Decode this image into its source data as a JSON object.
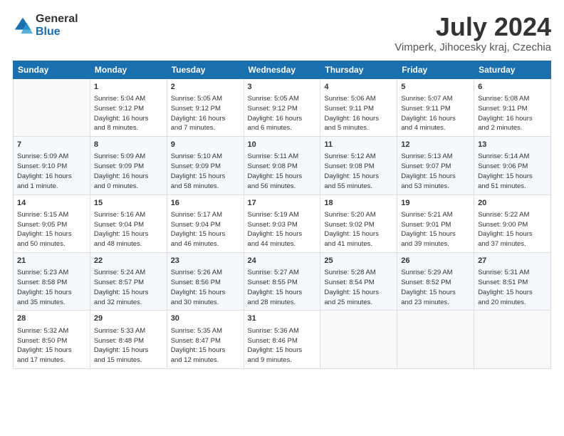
{
  "header": {
    "logo_general": "General",
    "logo_blue": "Blue",
    "month_year": "July 2024",
    "location": "Vimperk, Jihocesky kraj, Czechia"
  },
  "weekdays": [
    "Sunday",
    "Monday",
    "Tuesday",
    "Wednesday",
    "Thursday",
    "Friday",
    "Saturday"
  ],
  "weeks": [
    [
      {
        "day": "",
        "info": ""
      },
      {
        "day": "1",
        "info": "Sunrise: 5:04 AM\nSunset: 9:12 PM\nDaylight: 16 hours\nand 8 minutes."
      },
      {
        "day": "2",
        "info": "Sunrise: 5:05 AM\nSunset: 9:12 PM\nDaylight: 16 hours\nand 7 minutes."
      },
      {
        "day": "3",
        "info": "Sunrise: 5:05 AM\nSunset: 9:12 PM\nDaylight: 16 hours\nand 6 minutes."
      },
      {
        "day": "4",
        "info": "Sunrise: 5:06 AM\nSunset: 9:11 PM\nDaylight: 16 hours\nand 5 minutes."
      },
      {
        "day": "5",
        "info": "Sunrise: 5:07 AM\nSunset: 9:11 PM\nDaylight: 16 hours\nand 4 minutes."
      },
      {
        "day": "6",
        "info": "Sunrise: 5:08 AM\nSunset: 9:11 PM\nDaylight: 16 hours\nand 2 minutes."
      }
    ],
    [
      {
        "day": "7",
        "info": "Sunrise: 5:09 AM\nSunset: 9:10 PM\nDaylight: 16 hours\nand 1 minute."
      },
      {
        "day": "8",
        "info": "Sunrise: 5:09 AM\nSunset: 9:09 PM\nDaylight: 16 hours\nand 0 minutes."
      },
      {
        "day": "9",
        "info": "Sunrise: 5:10 AM\nSunset: 9:09 PM\nDaylight: 15 hours\nand 58 minutes."
      },
      {
        "day": "10",
        "info": "Sunrise: 5:11 AM\nSunset: 9:08 PM\nDaylight: 15 hours\nand 56 minutes."
      },
      {
        "day": "11",
        "info": "Sunrise: 5:12 AM\nSunset: 9:08 PM\nDaylight: 15 hours\nand 55 minutes."
      },
      {
        "day": "12",
        "info": "Sunrise: 5:13 AM\nSunset: 9:07 PM\nDaylight: 15 hours\nand 53 minutes."
      },
      {
        "day": "13",
        "info": "Sunrise: 5:14 AM\nSunset: 9:06 PM\nDaylight: 15 hours\nand 51 minutes."
      }
    ],
    [
      {
        "day": "14",
        "info": "Sunrise: 5:15 AM\nSunset: 9:05 PM\nDaylight: 15 hours\nand 50 minutes."
      },
      {
        "day": "15",
        "info": "Sunrise: 5:16 AM\nSunset: 9:04 PM\nDaylight: 15 hours\nand 48 minutes."
      },
      {
        "day": "16",
        "info": "Sunrise: 5:17 AM\nSunset: 9:04 PM\nDaylight: 15 hours\nand 46 minutes."
      },
      {
        "day": "17",
        "info": "Sunrise: 5:19 AM\nSunset: 9:03 PM\nDaylight: 15 hours\nand 44 minutes."
      },
      {
        "day": "18",
        "info": "Sunrise: 5:20 AM\nSunset: 9:02 PM\nDaylight: 15 hours\nand 41 minutes."
      },
      {
        "day": "19",
        "info": "Sunrise: 5:21 AM\nSunset: 9:01 PM\nDaylight: 15 hours\nand 39 minutes."
      },
      {
        "day": "20",
        "info": "Sunrise: 5:22 AM\nSunset: 9:00 PM\nDaylight: 15 hours\nand 37 minutes."
      }
    ],
    [
      {
        "day": "21",
        "info": "Sunrise: 5:23 AM\nSunset: 8:58 PM\nDaylight: 15 hours\nand 35 minutes."
      },
      {
        "day": "22",
        "info": "Sunrise: 5:24 AM\nSunset: 8:57 PM\nDaylight: 15 hours\nand 32 minutes."
      },
      {
        "day": "23",
        "info": "Sunrise: 5:26 AM\nSunset: 8:56 PM\nDaylight: 15 hours\nand 30 minutes."
      },
      {
        "day": "24",
        "info": "Sunrise: 5:27 AM\nSunset: 8:55 PM\nDaylight: 15 hours\nand 28 minutes."
      },
      {
        "day": "25",
        "info": "Sunrise: 5:28 AM\nSunset: 8:54 PM\nDaylight: 15 hours\nand 25 minutes."
      },
      {
        "day": "26",
        "info": "Sunrise: 5:29 AM\nSunset: 8:52 PM\nDaylight: 15 hours\nand 23 minutes."
      },
      {
        "day": "27",
        "info": "Sunrise: 5:31 AM\nSunset: 8:51 PM\nDaylight: 15 hours\nand 20 minutes."
      }
    ],
    [
      {
        "day": "28",
        "info": "Sunrise: 5:32 AM\nSunset: 8:50 PM\nDaylight: 15 hours\nand 17 minutes."
      },
      {
        "day": "29",
        "info": "Sunrise: 5:33 AM\nSunset: 8:48 PM\nDaylight: 15 hours\nand 15 minutes."
      },
      {
        "day": "30",
        "info": "Sunrise: 5:35 AM\nSunset: 8:47 PM\nDaylight: 15 hours\nand 12 minutes."
      },
      {
        "day": "31",
        "info": "Sunrise: 5:36 AM\nSunset: 8:46 PM\nDaylight: 15 hours\nand 9 minutes."
      },
      {
        "day": "",
        "info": ""
      },
      {
        "day": "",
        "info": ""
      },
      {
        "day": "",
        "info": ""
      }
    ]
  ]
}
